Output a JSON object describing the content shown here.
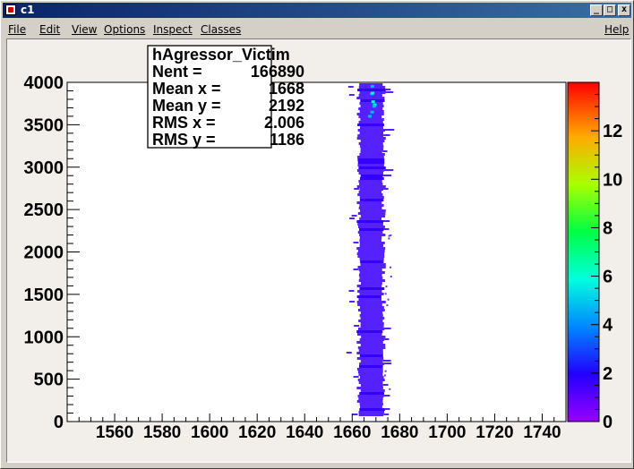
{
  "window": {
    "title": "c1",
    "buttons": {
      "minimize": "_",
      "maximize": "□",
      "close": "x"
    }
  },
  "menu": {
    "items": [
      "File",
      "Edit",
      "View",
      "Options",
      "Inspect",
      "Classes"
    ],
    "help": "Help"
  },
  "stats": {
    "title": "hAgressor_Victim",
    "lines": [
      {
        "label": "Nent =",
        "value": "166890"
      },
      {
        "label": "Mean x =",
        "value": "1668"
      },
      {
        "label": "Mean y =",
        "value": "2192"
      },
      {
        "label": "RMS x  =",
        "value": "2.006"
      },
      {
        "label": "RMS y  =",
        "value": "1186"
      }
    ]
  },
  "chart_data": {
    "type": "heatmap",
    "title": "",
    "xlabel": "",
    "ylabel": "",
    "xlim": [
      1540,
      1750
    ],
    "ylim": [
      0,
      4000
    ],
    "zlim": [
      0,
      14
    ],
    "x_ticks": [
      "1560",
      "1580",
      "1600",
      "1620",
      "1640",
      "1660",
      "1680",
      "1700",
      "1720",
      "1740"
    ],
    "x_tick_values": [
      1560,
      1580,
      1600,
      1620,
      1640,
      1660,
      1680,
      1700,
      1720,
      1740
    ],
    "y_ticks": [
      "0",
      "500",
      "1000",
      "1500",
      "2000",
      "2500",
      "3000",
      "3500",
      "4000"
    ],
    "y_tick_values": [
      0,
      500,
      1000,
      1500,
      2000,
      2500,
      3000,
      3500,
      4000
    ],
    "z_ticks": [
      "0",
      "2",
      "4",
      "6",
      "8",
      "10",
      "12"
    ],
    "z_tick_values": [
      0,
      2,
      4,
      6,
      8,
      10,
      12
    ],
    "band": {
      "x_center": 1668,
      "x_rms": 2.006,
      "entries": 166890
    },
    "grid": false,
    "legend": "color palette on right"
  }
}
